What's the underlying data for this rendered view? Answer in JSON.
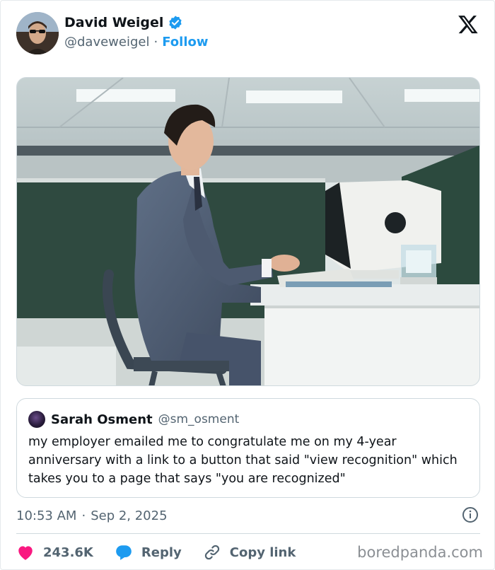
{
  "author": {
    "display_name": "David Weigel",
    "handle": "@daveweigel",
    "separator": "·",
    "follow_label": "Follow"
  },
  "quote": {
    "display_name": "Sarah Osment",
    "handle": "@sm_osment",
    "text": "my employer emailed me to congratulate me on my 4-year anniversary with a link to a button that said \"view recognition\" which takes you to a page that says \"you are recognized\""
  },
  "meta": {
    "time": "10:53 AM",
    "separator": "·",
    "date": "Sep 2, 2025"
  },
  "actions": {
    "like_count": "243.6K",
    "reply_label": "Reply",
    "copy_link_label": "Copy link"
  },
  "watermark": "boredpanda.com",
  "colors": {
    "accent": "#1d9bf0",
    "like": "#f91880",
    "text": "#0f1419",
    "muted": "#536471"
  },
  "icons": [
    "verified-badge-icon",
    "x-logo-icon",
    "info-icon",
    "heart-icon",
    "reply-bubble-icon",
    "link-icon"
  ]
}
